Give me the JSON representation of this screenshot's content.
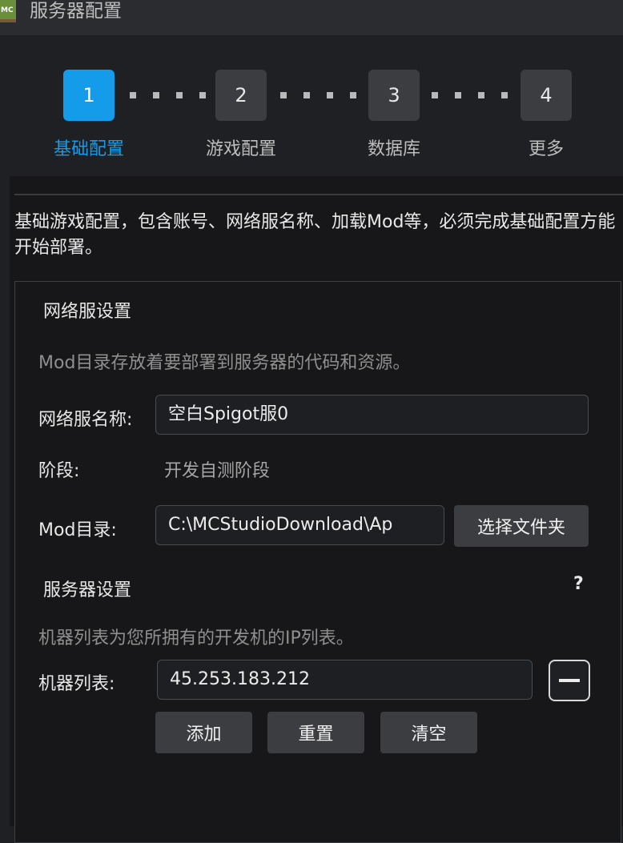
{
  "window": {
    "title": "服务器配置",
    "icon_name": "minecraft-icon",
    "icon_text": "MC"
  },
  "steps": [
    {
      "number": "1",
      "label": "基础配置",
      "active": true
    },
    {
      "number": "2",
      "label": "游戏配置",
      "active": false
    },
    {
      "number": "3",
      "label": "数据库",
      "active": false
    },
    {
      "number": "4",
      "label": "更多",
      "active": false
    }
  ],
  "description": "基础游戏配置，包含账号、网络服名称、加载Mod等，必须完成基础配置方能开始部署。",
  "network": {
    "section_title": "网络服设置",
    "hint": "Mod目录存放着要部署到服务器的代码和资源。",
    "name_label": "网络服名称:",
    "name_value": "空白Spigot服0",
    "stage_label": "阶段:",
    "stage_value": "开发自测阶段",
    "mod_label": "Mod目录:",
    "mod_value": "C:\\MCStudioDownload\\Ap",
    "choose_folder_label": "选择文件夹"
  },
  "server": {
    "section_title": "服务器设置",
    "help_icon": "?",
    "hint": "机器列表为您所拥有的开发机的IP列表。",
    "machine_label": "机器列表:",
    "machine_value": "45.253.183.212",
    "remove_icon": "minus-icon",
    "add_label": "添加",
    "reset_label": "重置",
    "clear_label": "清空"
  },
  "colors": {
    "accent": "#149bea",
    "background": "#1f2023",
    "panel": "#171719"
  }
}
